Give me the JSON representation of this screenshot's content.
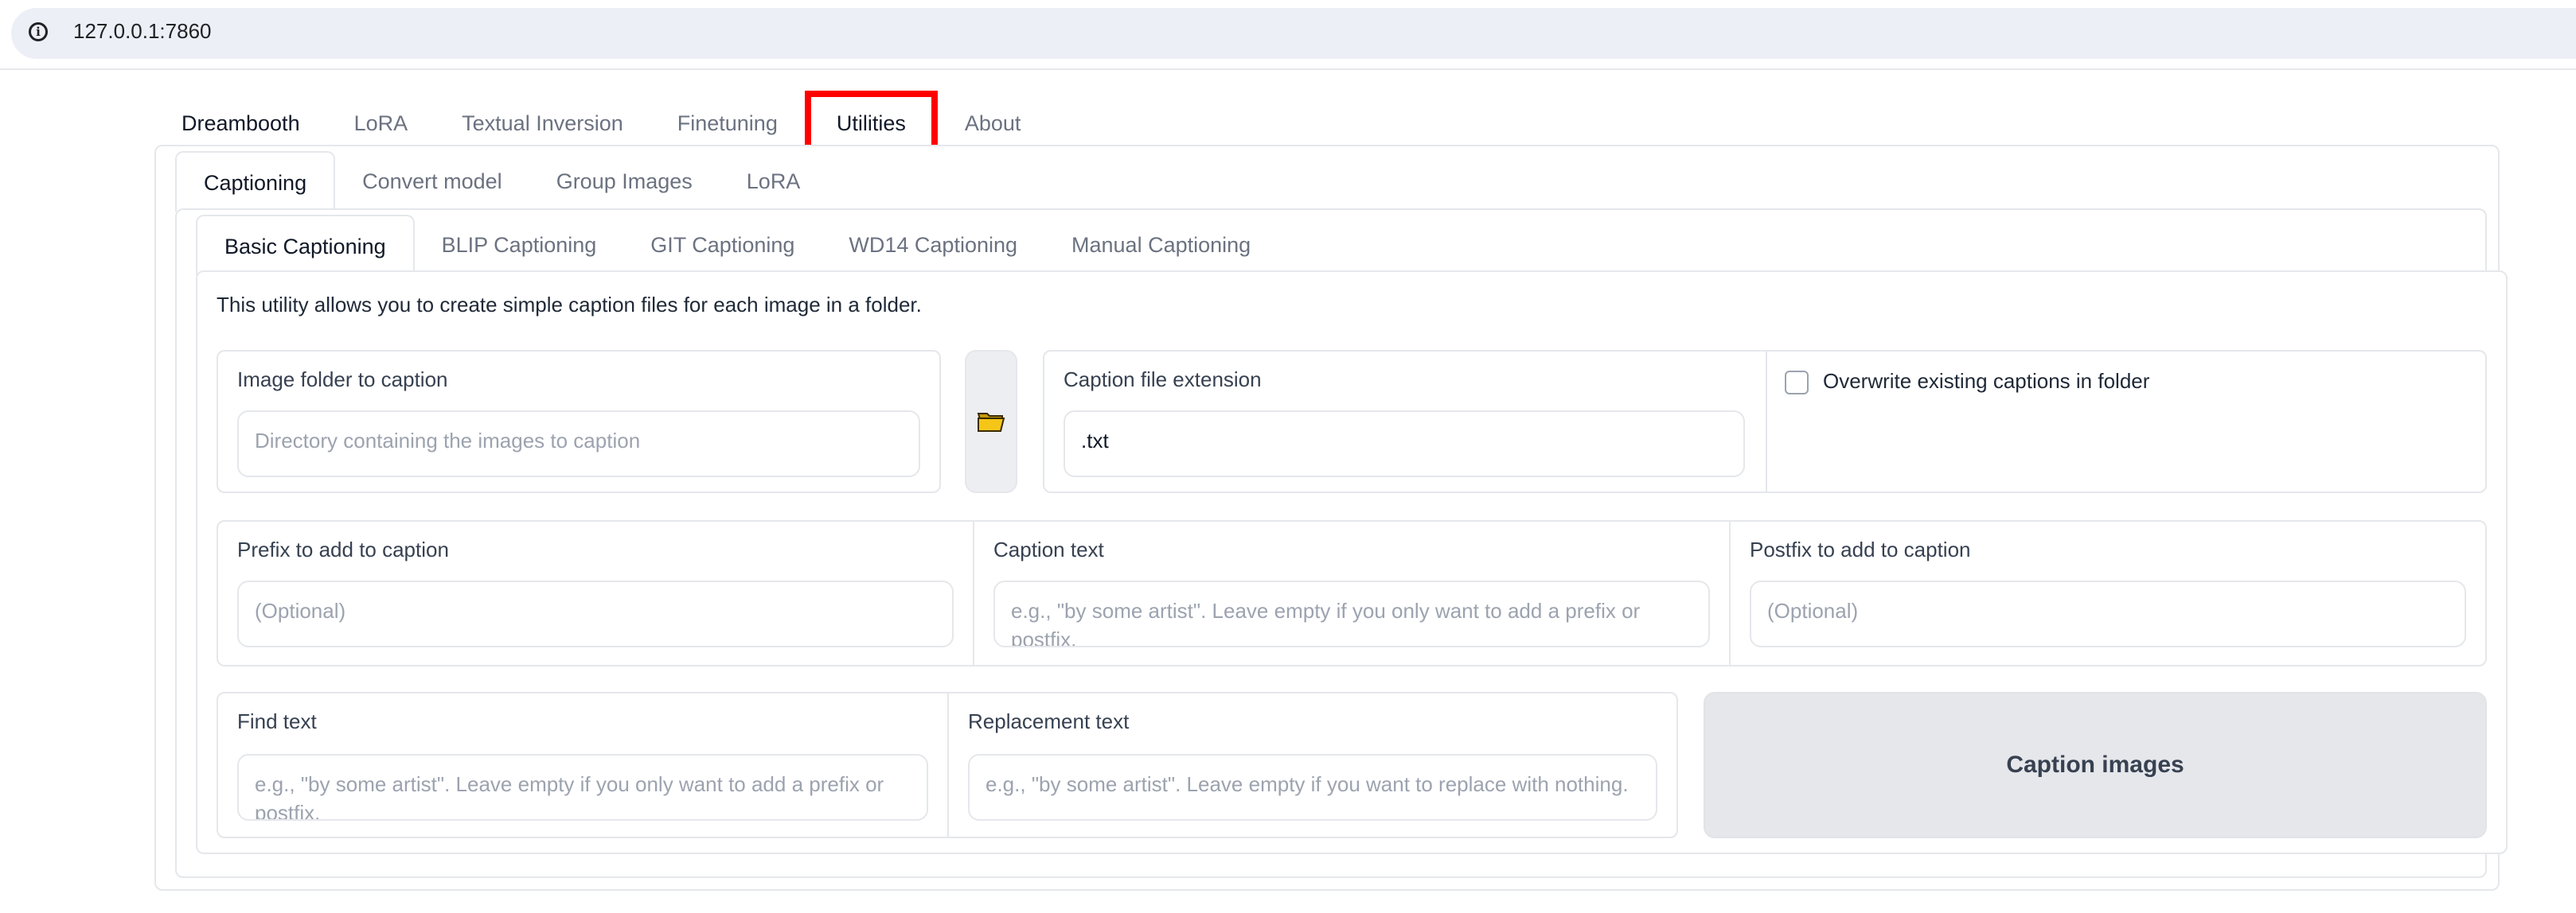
{
  "browser": {
    "url": "127.0.0.1:7860"
  },
  "main_tabs": [
    "Dreambooth",
    "LoRA",
    "Textual Inversion",
    "Finetuning",
    "Utilities",
    "About"
  ],
  "utility_tabs": [
    "Captioning",
    "Convert model",
    "Group Images",
    "LoRA"
  ],
  "caption_tabs": [
    "Basic Captioning",
    "BLIP Captioning",
    "GIT Captioning",
    "WD14 Captioning",
    "Manual Captioning"
  ],
  "basic": {
    "description": "This utility allows you to create simple caption files for each image in a folder.",
    "image_folder": {
      "label": "Image folder to caption",
      "placeholder": "Directory containing the images to caption"
    },
    "folder_icon": "folder-icon",
    "extension": {
      "label": "Caption file extension",
      "value": ".txt"
    },
    "overwrite": {
      "label": "Overwrite existing captions in folder",
      "checked": false
    },
    "prefix": {
      "label": "Prefix to add to caption",
      "placeholder": "(Optional)"
    },
    "caption_text": {
      "label": "Caption text",
      "placeholder": "e.g., \"by some artist\". Leave empty if you only want to add a prefix or postfix."
    },
    "postfix": {
      "label": "Postfix to add to caption",
      "placeholder": "(Optional)"
    },
    "find": {
      "label": "Find text",
      "placeholder": "e.g., \"by some artist\". Leave empty if you only want to add a prefix or postfix."
    },
    "replace": {
      "label": "Replacement text",
      "placeholder": "e.g., \"by some artist\". Leave empty if you want to replace with nothing."
    },
    "button": "Caption images"
  },
  "colors": {
    "highlight": "#ff0000",
    "button_bg": "#e5e7eb",
    "folder_icon": "#f5c518"
  }
}
